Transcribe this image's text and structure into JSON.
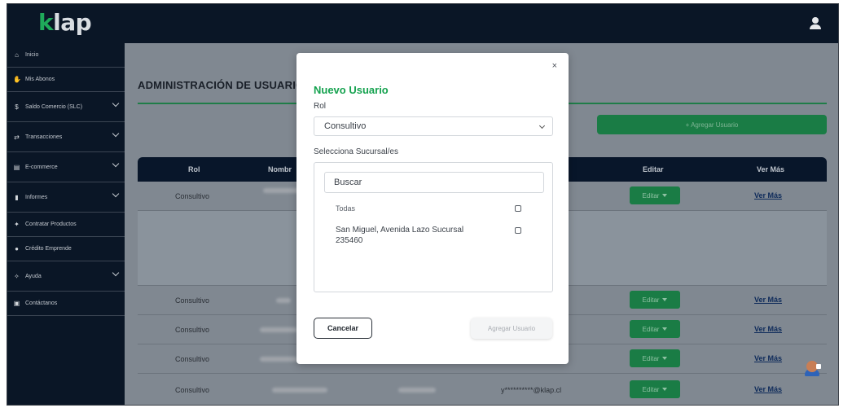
{
  "app": {
    "logo_prefix": "k",
    "logo_rest": "lap"
  },
  "sidebar": {
    "items": [
      {
        "label": "Inicio",
        "icon": "home-icon",
        "glyph": "⌂",
        "has_chevron": false
      },
      {
        "label": "Mis Abonos",
        "icon": "hand-icon",
        "glyph": "✋",
        "has_chevron": false
      },
      {
        "label": "Saldo Comercio (SLC)",
        "icon": "dollar-icon",
        "glyph": "$",
        "has_chevron": true
      },
      {
        "label": "Transacciones",
        "icon": "exchange-icon",
        "glyph": "⇄",
        "has_chevron": true
      },
      {
        "label": "E-commerce",
        "icon": "store-icon",
        "glyph": "▤",
        "has_chevron": true
      },
      {
        "label": "Informes",
        "icon": "file-icon",
        "glyph": "▮",
        "has_chevron": true
      },
      {
        "label": "Contratar Productos",
        "icon": "gift-icon",
        "glyph": "✦",
        "has_chevron": false
      },
      {
        "label": "Crédito Emprende",
        "icon": "circle-info-icon",
        "glyph": "●",
        "has_chevron": false
      },
      {
        "label": "Ayuda",
        "icon": "help-icon",
        "glyph": "✧",
        "has_chevron": true
      },
      {
        "label": "Contáctanos",
        "icon": "contact-icon",
        "glyph": "▣",
        "has_chevron": false
      }
    ]
  },
  "main": {
    "title": "ADMINISTRACIÓN DE USUARIO",
    "add_button": "+ Agregar Usuario",
    "table": {
      "headers": {
        "rol": "Rol",
        "nombre": "Nombr",
        "editar": "Editar",
        "ver_mas": "Ver Más"
      },
      "rows": [
        {
          "rol": "Consultivo",
          "email": "",
          "edit": "Editar",
          "ver": "Ver Más"
        },
        {
          "rol": "Consultivo",
          "email": "",
          "edit": "Editar",
          "ver": "Ver Más"
        },
        {
          "rol": "Consultivo",
          "email": "",
          "edit": "Editar",
          "ver": "Ver Más"
        },
        {
          "rol": "Consultivo",
          "email": "",
          "edit": "Editar",
          "ver": "Ver Más"
        },
        {
          "rol": "Consultivo",
          "email": "y**********@klap.cl",
          "edit": "Editar",
          "ver": "Ver Más"
        }
      ]
    }
  },
  "modal": {
    "close": "×",
    "title": "Nuevo Usuario",
    "rol_label": "Rol",
    "rol_value": "Consultivo",
    "sucursal_label": "Selecciona Sucursal/es",
    "search_placeholder": "Buscar",
    "option_all": "Todas",
    "option_1": "San Miguel, Avenida Lazo Sucursal 235460",
    "cancel": "Cancelar",
    "submit": "Agregar Usuario"
  },
  "colors": {
    "brand_green": "#15a24f",
    "nav_dark": "#0a1626",
    "button_green": "#1a7c45"
  }
}
